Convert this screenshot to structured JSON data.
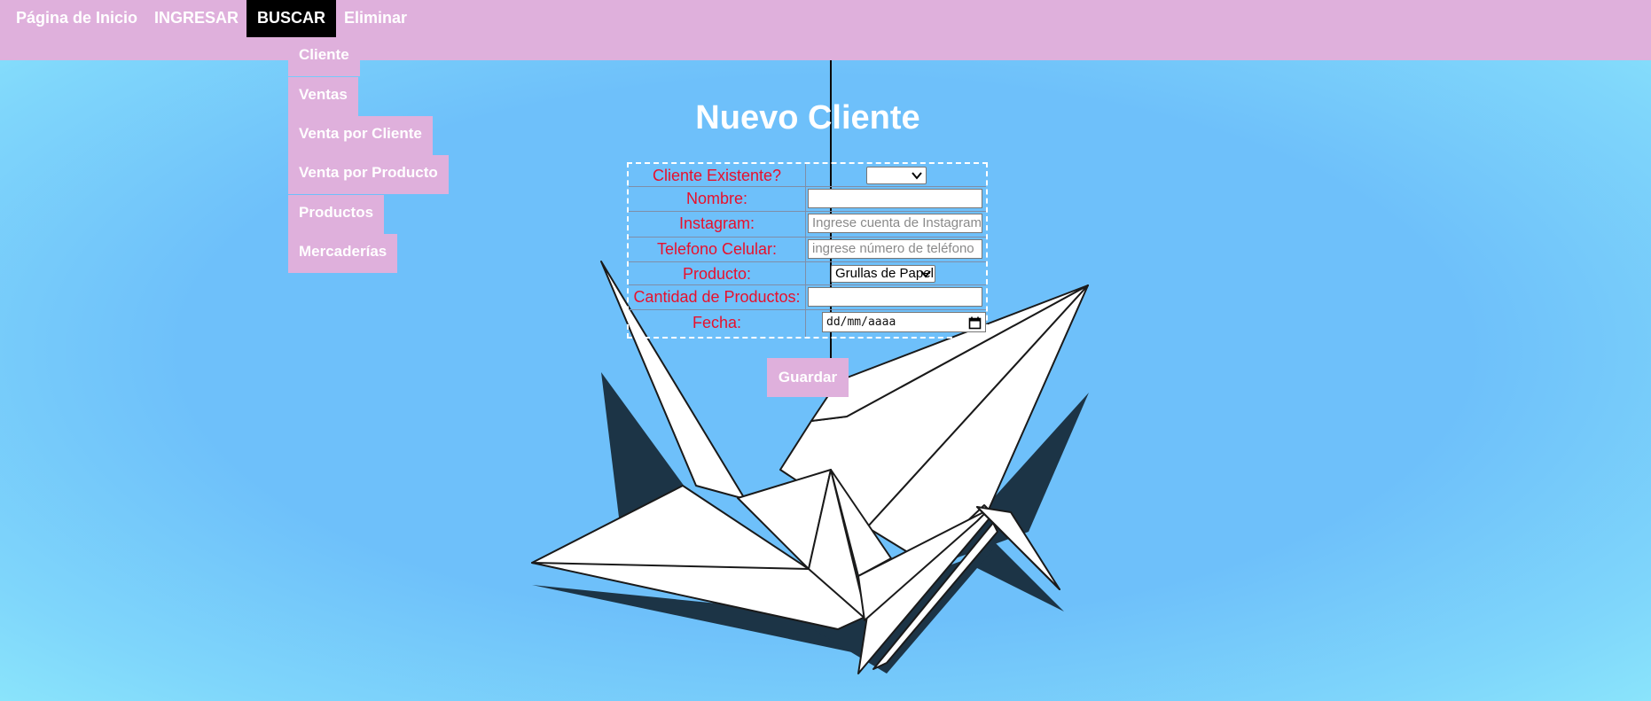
{
  "navbar": {
    "items": [
      {
        "label": "Página de Inicio"
      },
      {
        "label": "INGRESAR"
      },
      {
        "label": "BUSCAR"
      },
      {
        "label": "Eliminar"
      }
    ]
  },
  "dropdown": {
    "items": [
      {
        "label": "Cliente"
      },
      {
        "label": "Ventas"
      },
      {
        "label": "Venta por Cliente"
      },
      {
        "label": "Venta por Producto"
      },
      {
        "label": "Productos"
      },
      {
        "label": "Mercaderías"
      }
    ]
  },
  "page": {
    "title": "Nuevo Cliente"
  },
  "form": {
    "existing_label": "Cliente Existente?",
    "existing_value": "",
    "name_label": "Nombre:",
    "name_value": "",
    "instagram_label": "Instagram:",
    "instagram_placeholder": "Ingrese cuenta de Instagram",
    "phone_label": "Telefono Celular:",
    "phone_placeholder": "ingrese número de teléfono",
    "product_label": "Producto:",
    "product_value": "Grullas de Papel",
    "quantity_label": "Cantidad de Productos:",
    "quantity_value": "",
    "date_label": "Fecha:",
    "date_placeholder": "dd/mm/aaaa",
    "save_label": "Guardar"
  },
  "icons": {
    "chevron": "chevron-down-icon",
    "calendar": "calendar-icon",
    "background": "paper-crane-illustration"
  },
  "colors": {
    "navbar_bg": "#dfb0dc",
    "active_nav_bg": "#000000",
    "label_text": "#e8102c",
    "background": "#6ec0fa"
  }
}
